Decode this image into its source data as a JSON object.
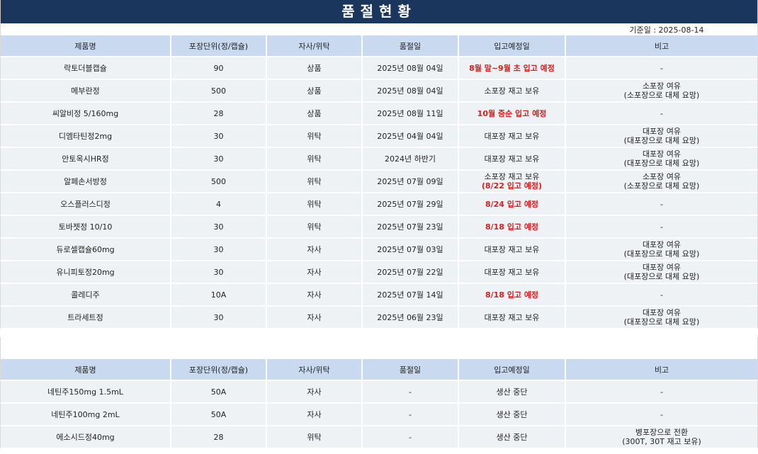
{
  "header": {
    "title": "품절현황",
    "base_date": "기준일 : 2025-08-14"
  },
  "columns": [
    "제품명",
    "포장단위(정/캡슐)",
    "자사/위탁",
    "품절일",
    "입고예정일",
    "비고"
  ],
  "table1": {
    "rows": [
      {
        "name": "락토더블캡슐",
        "unit": "90",
        "type": "상품",
        "date": "2025년 08월 04일",
        "eta": [
          "8월 말~9월 초 입고 예정"
        ],
        "eta_red": true,
        "note": [
          "-"
        ]
      },
      {
        "name": "메부란정",
        "unit": "500",
        "type": "상품",
        "date": "2025년 08월 04일",
        "eta": [
          "소포장 재고 보유"
        ],
        "eta_red": false,
        "note": [
          "소포장 여유",
          "(소포장으로 대체 요망)"
        ]
      },
      {
        "name": "씨알비정 5/160mg",
        "unit": "28",
        "type": "상품",
        "date": "2025년 08월 11일",
        "eta": [
          "10월 중순 입고 예정"
        ],
        "eta_red": true,
        "note": [
          "-"
        ]
      },
      {
        "name": "디엠타틴정2mg",
        "unit": "30",
        "type": "위탁",
        "date": "2025년 04월 04일",
        "eta": [
          "대포장 재고 보유"
        ],
        "eta_red": false,
        "note": [
          "대포장 여유",
          "(대포장으로 대체 요망)"
        ]
      },
      {
        "name": "안토옥시HR정",
        "unit": "30",
        "type": "위탁",
        "date": "2024년 하반기",
        "eta": [
          "대포장 재고 보유"
        ],
        "eta_red": false,
        "note": [
          "대포장 여유",
          "(대포장으로 대체 요망)"
        ]
      },
      {
        "name": "알페손서방정",
        "unit": "500",
        "type": "위탁",
        "date": "2025년 07월 09일",
        "eta": [
          "소포장 재고 보유",
          "(8/22 입고 예정)"
        ],
        "eta_red": false,
        "eta_second_red": true,
        "note": [
          "소포장 여유",
          "(소포장으로 대체 요망)"
        ]
      },
      {
        "name": "오스플러스디정",
        "unit": "4",
        "type": "위탁",
        "date": "2025년 07월 29일",
        "eta": [
          "8/24 입고 예정"
        ],
        "eta_red": true,
        "note": [
          "-"
        ]
      },
      {
        "name": "토바젯정 10/10",
        "unit": "30",
        "type": "위탁",
        "date": "2025년 07월 23일",
        "eta": [
          "8/18 입고 예정"
        ],
        "eta_red": true,
        "note": [
          "-"
        ]
      },
      {
        "name": "듀로셀캡슐60mg",
        "unit": "30",
        "type": "자사",
        "date": "2025년 07월 03일",
        "eta": [
          "대포장 재고 보유"
        ],
        "eta_red": false,
        "note": [
          "대포장 여유",
          "(대포장으로 대체 요망)"
        ]
      },
      {
        "name": "유니피토정20mg",
        "unit": "30",
        "type": "자사",
        "date": "2025년 07월 22일",
        "eta": [
          "대포장 재고 보유"
        ],
        "eta_red": false,
        "note": [
          "대포장 여유",
          "(대포장으로 대체 요망)"
        ]
      },
      {
        "name": "콜레디주",
        "unit": "10A",
        "type": "자사",
        "date": "2025년 07월 14일",
        "eta": [
          "8/18 입고 예정"
        ],
        "eta_red": true,
        "note": [
          "-"
        ]
      },
      {
        "name": "트라세트정",
        "unit": "30",
        "type": "자사",
        "date": "2025년 06월 23일",
        "eta": [
          "대포장 재고 보유"
        ],
        "eta_red": false,
        "note": [
          "대포장 여유",
          "(대포장으로 대체 요망)"
        ]
      }
    ]
  },
  "table2": {
    "rows": [
      {
        "name": "네틴주150mg 1.5mL",
        "unit": "50A",
        "type": "자사",
        "date": "-",
        "eta": [
          "생산 중단"
        ],
        "eta_red": false,
        "note": [
          "-"
        ]
      },
      {
        "name": "네틴주100mg 2mL",
        "unit": "50A",
        "type": "자사",
        "date": "-",
        "eta": [
          "생산 중단"
        ],
        "eta_red": false,
        "note": [
          "-"
        ]
      },
      {
        "name": "에소시드정40mg",
        "unit": "28",
        "type": "위탁",
        "date": "-",
        "eta": [
          "생산 중단"
        ],
        "eta_red": false,
        "note": [
          "병포장으로 전환",
          "(300T, 30T 재고 보유)"
        ]
      }
    ]
  },
  "colors": {
    "title_bg": "#1b365d",
    "header_bg": "#c9daf0",
    "row_bg": "#eef2f5",
    "alert_text": "#d42020"
  }
}
